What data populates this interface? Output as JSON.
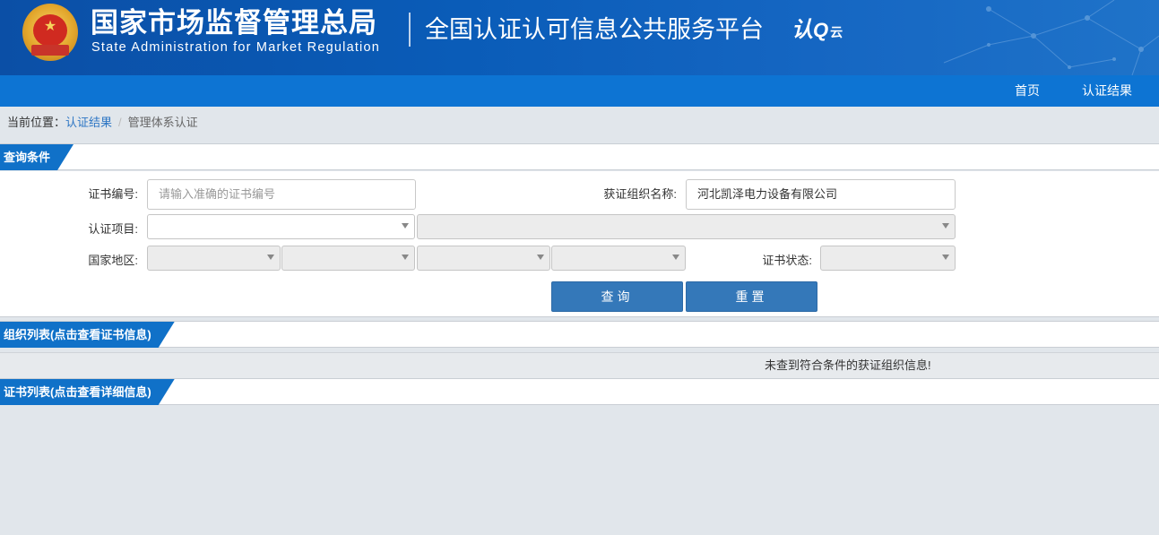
{
  "header": {
    "agency_cn": "国家市场监督管理总局",
    "agency_en": "State Administration  for  Market Regulation",
    "platform_title": "全国认证认可信息公共服务平台",
    "logo_text": "认",
    "logo_cloud": "云"
  },
  "nav": {
    "home": "首页",
    "cert_results": "认证结果"
  },
  "breadcrumb": {
    "label": "当前位置：",
    "link": "认证结果",
    "current": "管理体系认证"
  },
  "query": {
    "section_title": "查询条件",
    "cert_no_label": "证书编号:",
    "cert_no_placeholder": "请输入准确的证书编号",
    "org_name_label": "获证组织名称:",
    "org_name_value": "河北凯泽电力设备有限公司",
    "cert_item_label": "认证项目:",
    "region_label": "国家地区:",
    "status_label": "证书状态:",
    "query_button": "查询",
    "reset_button": "重置"
  },
  "org_list": {
    "section_title": "组织列表(点击查看证书信息)",
    "empty_message": "未查到符合条件的获证组织信息!"
  },
  "cert_list": {
    "section_title": "证书列表(点击查看详细信息)"
  },
  "colors": {
    "banner": "#0b4fa6",
    "navbar": "#0d74d3",
    "tab": "#1071c8",
    "button": "#3478b9",
    "link": "#2d76c4"
  }
}
